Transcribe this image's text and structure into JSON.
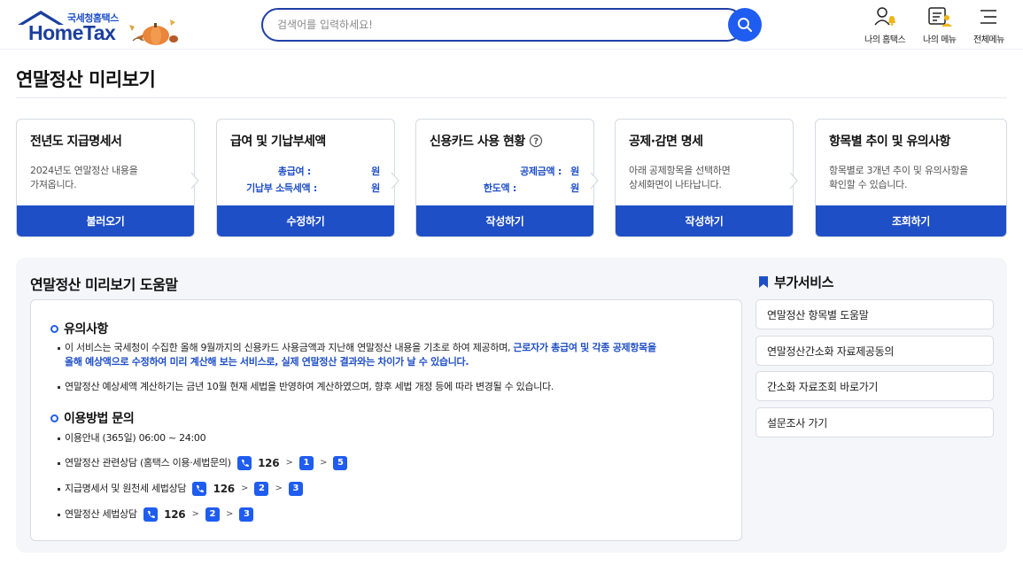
{
  "header": {
    "logo_sub": "국세청홈택스",
    "logo_main": "HomeTax",
    "search_placeholder": "검색어를 입력하세요!",
    "menus": [
      {
        "label": "나의 홈택스",
        "icon": "user-bell-icon"
      },
      {
        "label": "나의 메뉴",
        "icon": "user-list-icon"
      },
      {
        "label": "전체메뉴",
        "icon": "hamburger-icon"
      }
    ]
  },
  "page_title": "연말정산 미리보기",
  "steps": [
    {
      "title": "전년도 지급명세서",
      "desc1": "2024년도 연말정산 내용을",
      "desc2": "가져옵니다.",
      "button": "불러오기"
    },
    {
      "title": "급여 및 기납부세액",
      "k1": "총급여 :",
      "v1": "원",
      "k2": "기납부 소득세액 :",
      "v2": "원",
      "button": "수정하기"
    },
    {
      "title": "신용카드 사용 현황",
      "k1": "공제금액 :",
      "v1": "원",
      "k2": "한도액 :",
      "v2": "원",
      "button": "작성하기"
    },
    {
      "title": "공제·감면 명세",
      "desc1": "아래 공제항목을 선택하면",
      "desc2": "상세화면이 나타납니다.",
      "button": "작성하기"
    },
    {
      "title": "항목별 추이 및 유의사항",
      "desc1": "항목별로 3개년 추이 및 유의사항을",
      "desc2": "확인할 수 있습니다.",
      "button": "조회하기"
    }
  ],
  "help": {
    "title": "연말정산 미리보기 도움말",
    "notice_title": "유의사항",
    "notice1_plain": "이 서비스는 국세청이 수집한 올해 9월까지의 신용카드 사용금액과 지난해 연말정산 내용을 기초로 하여 제공하며,",
    "notice1_hl_a": "근로자가 총급여 및 각종 공제항목을",
    "notice1_hl_b": "올해 예상액으로 수정하여 미리 계산해 보는 서비스로, 실제 연말정산 결과와는 차이가 날 수 있습니다.",
    "notice2": "연말정산 예상세액 계산하기는 금년 10월 현재 세법을 반영하여 계산하였으며, 향후 세법 개정 등에 따라 변경될 수 있습니다.",
    "inquiry_title": "이용방법 문의",
    "hours": "이용안내 (365일) 06:00 ~ 24:00",
    "lines": [
      {
        "label": "연말정산 관련상담 (홈택스 이용·세법문의)",
        "num": "126",
        "k1": "1",
        "k2": "5"
      },
      {
        "label": "지급명세서 및 원천세 세법상담",
        "num": "126",
        "k1": "2",
        "k2": "3"
      },
      {
        "label": "연말정산 세법상담",
        "num": "126",
        "k1": "2",
        "k2": "3"
      }
    ]
  },
  "side": {
    "title": "부가서비스",
    "items": [
      "연말정산 항목별 도움말",
      "연말정산간소화 자료제공동의",
      "간소화 자료조회 바로가기",
      "설문조사 가기"
    ]
  },
  "colors": {
    "primary": "#1f4fc7",
    "accent": "#1f5cf0",
    "panel_bg": "#f4f6fa"
  }
}
